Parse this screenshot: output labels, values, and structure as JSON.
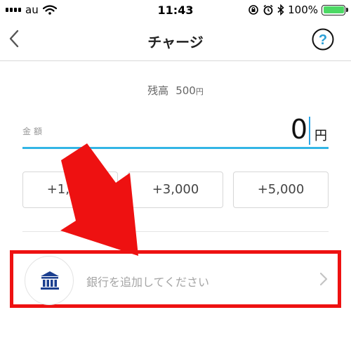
{
  "status_bar": {
    "carrier": "au",
    "time": "11:43",
    "battery_percent": "100%",
    "battery_level": 1.0,
    "icons": [
      "signal-icon",
      "wifi-icon",
      "rotation-lock-icon",
      "alarm-icon",
      "bluetooth-icon",
      "battery-icon"
    ]
  },
  "nav": {
    "title": "チャージ",
    "back_icon": "chevron-left-icon",
    "help_icon": "question-circle-icon",
    "help_glyph": "?"
  },
  "balance": {
    "label": "残高",
    "amount": "500",
    "unit": "円"
  },
  "amount_field": {
    "label": "金額",
    "value": "0",
    "unit": "円"
  },
  "quick_buttons": [
    {
      "label": "+1,000"
    },
    {
      "label": "+3,000"
    },
    {
      "label": "+5,000"
    }
  ],
  "bank": {
    "label": "銀行を追加してください",
    "icon": "bank-icon",
    "chevron": "chevron-right-icon"
  },
  "colors": {
    "accent_blue": "#33b5e5",
    "help_blue": "#2a9fd6",
    "bank_navy": "#1b3f8f",
    "highlight_red": "#ee1111",
    "battery_green": "#4cd964"
  }
}
